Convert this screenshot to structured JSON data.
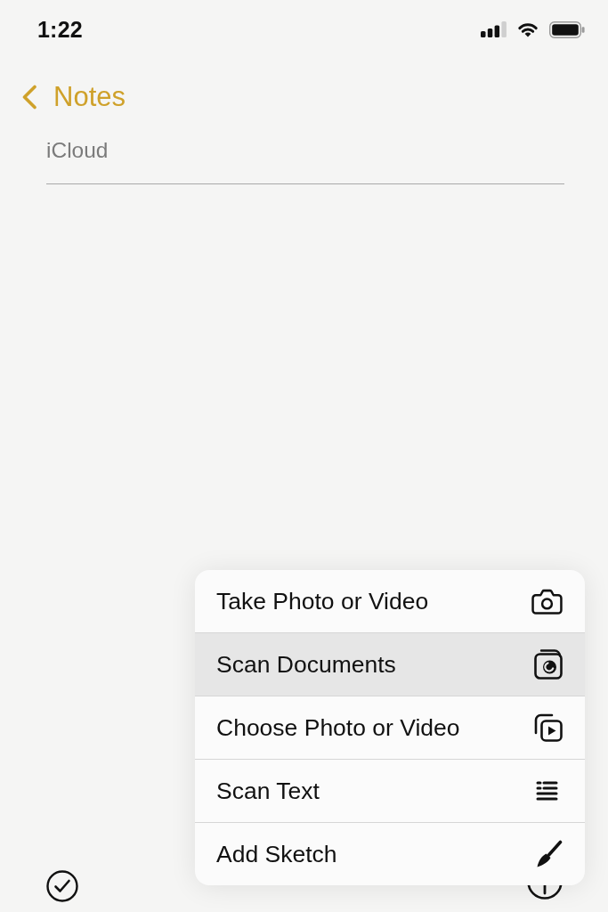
{
  "status_bar": {
    "time": "1:22"
  },
  "nav": {
    "back_label": "Notes"
  },
  "note": {
    "account_label": "iCloud"
  },
  "menu": {
    "items": [
      {
        "label": "Take Photo or Video",
        "kind": "camera",
        "selected": false
      },
      {
        "label": "Scan Documents",
        "kind": "scan_documents",
        "selected": true
      },
      {
        "label": "Choose Photo or Video",
        "kind": "photo_library",
        "selected": false
      },
      {
        "label": "Scan Text",
        "kind": "scan_text",
        "selected": false
      },
      {
        "label": "Add Sketch",
        "kind": "sketch",
        "selected": false
      }
    ]
  }
}
